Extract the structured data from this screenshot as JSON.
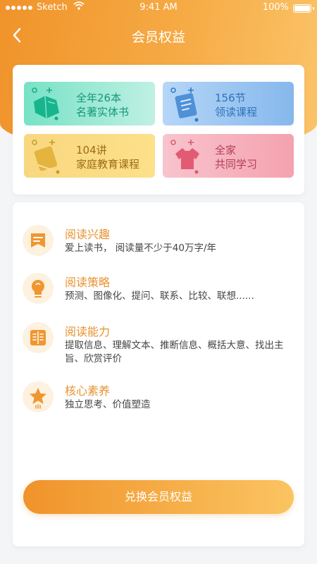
{
  "status_bar": {
    "carrier": "Sketch",
    "time": "9:41 AM",
    "battery": "100%"
  },
  "nav": {
    "title": "会员权益",
    "back_icon": "chevron-left-icon"
  },
  "benefits": [
    {
      "line1": "全年26本",
      "line2": "名著实体书",
      "icon": "book-icon",
      "color": "#16977a"
    },
    {
      "line1": "156节",
      "line2": "领读课程",
      "icon": "document-icon",
      "color": "#2f72b9"
    },
    {
      "line1": "104讲",
      "line2": "家庭教育课程",
      "icon": "notebook-icon",
      "color": "#9c6c14"
    },
    {
      "line1": "全家",
      "line2": "共同学习",
      "icon": "shirt-icon",
      "color": "#b13e54"
    }
  ],
  "features": [
    {
      "title": "阅读兴趣",
      "desc": "爱上读书，  阅读量不少于40万字/年",
      "icon": "bookmark-icon"
    },
    {
      "title": "阅读策略",
      "desc": "预测、图像化、提问、联系、比较、联想......",
      "icon": "lightbulb-icon"
    },
    {
      "title": "阅读能力",
      "desc": "提取信息、理解文本、推断信息、概括大意、找出主旨、欣赏评价",
      "icon": "open-book-icon"
    },
    {
      "title": "核心素养",
      "desc": "独立思考、价值塑造",
      "icon": "star-icon"
    }
  ],
  "redeem_button": "兑换会员权益",
  "colors": {
    "accent": "#f0932a",
    "accent_light": "#fbc461",
    "feature_title": "#e7922f"
  }
}
